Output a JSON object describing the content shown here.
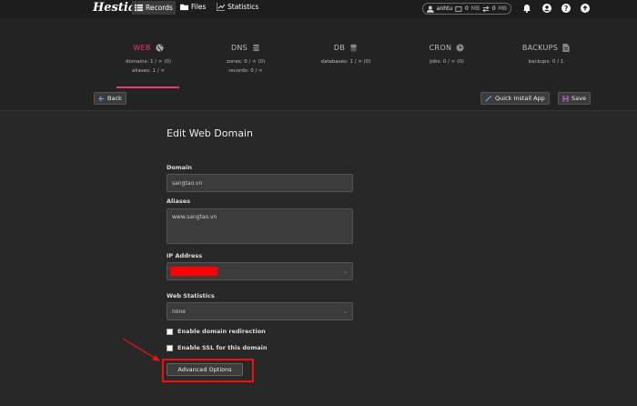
{
  "topbar": {
    "logo": "Hestia",
    "nav": [
      {
        "label": "Records",
        "icon": "list-icon"
      },
      {
        "label": "Files",
        "icon": "folder-icon"
      },
      {
        "label": "Statistics",
        "icon": "chart-icon"
      }
    ],
    "user": {
      "name": "anhtu",
      "disk": "0",
      "disk_unit": "MB",
      "bandwidth": "0",
      "bandwidth_unit": "MB"
    }
  },
  "tabs": [
    {
      "name": "WEB",
      "icon": "globe-icon",
      "stats": [
        "domains: 1 / ∞ (0)",
        "aliases: 1 / ∞"
      ]
    },
    {
      "name": "DNS",
      "icon": "database-icon",
      "stats": [
        "zones: 0 / ∞ (0)",
        "records: 0 / ∞"
      ]
    },
    {
      "name": "DB",
      "icon": "database-icon",
      "stats": [
        "databases: 1 / ∞ (0)"
      ]
    },
    {
      "name": "CRON",
      "icon": "clock-icon",
      "stats": [
        "jobs: 0 / ∞ (0)"
      ]
    },
    {
      "name": "BACKUPS",
      "icon": "file-icon",
      "stats": [
        "backups: 0 / 1"
      ]
    }
  ],
  "toolbar": {
    "back": "Back",
    "quick_install": "Quick Install App",
    "save": "Save"
  },
  "form": {
    "title": "Edit Web Domain",
    "domain_label": "Domain",
    "domain_value": "sangtao.vn",
    "aliases_label": "Aliases",
    "aliases_value": "www.sangtao.vn",
    "ip_label": "IP Address",
    "stats_label": "Web Statistics",
    "stats_value": "none",
    "redirect_label": "Enable domain redirection",
    "ssl_label": "Enable SSL for this domain",
    "advanced_button": "Advanced Options"
  },
  "colors": {
    "accent": "#f0357a",
    "annotation": "#ee1111"
  }
}
